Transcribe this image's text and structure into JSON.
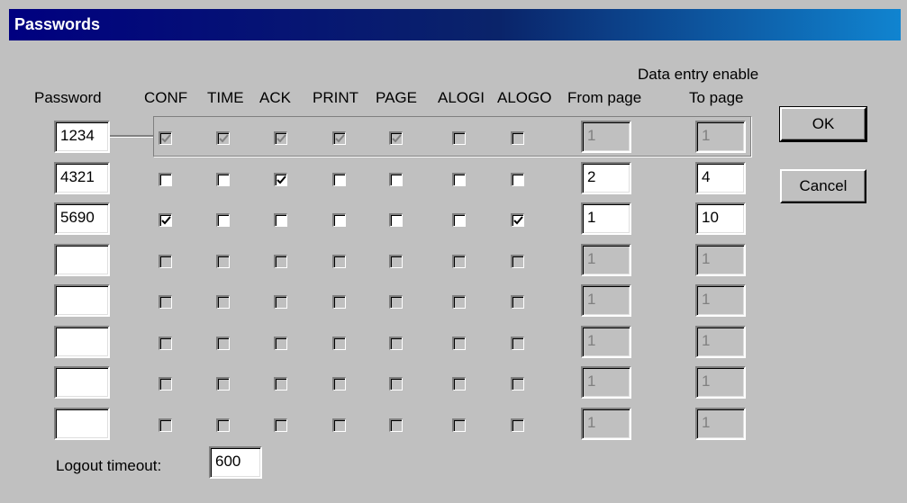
{
  "window": {
    "title": "Passwords"
  },
  "headers": {
    "password": "Password",
    "conf": "CONF",
    "time": "TIME",
    "ack": "ACK",
    "print": "PRINT",
    "page": "PAGE",
    "alogi": "ALOGI",
    "alogo": "ALOGO",
    "data_entry": "Data entry enable",
    "from_page": "From page",
    "to_page": "To page"
  },
  "rows": [
    {
      "password": "1234",
      "enabled": false,
      "checks": [
        true,
        true,
        true,
        true,
        true,
        false,
        false
      ],
      "from_page": "1",
      "to_page": "1"
    },
    {
      "password": "4321",
      "enabled": true,
      "checks": [
        false,
        false,
        true,
        false,
        false,
        false,
        false
      ],
      "from_page": "2",
      "to_page": "4"
    },
    {
      "password": "5690",
      "enabled": true,
      "checks": [
        true,
        false,
        false,
        false,
        false,
        false,
        true
      ],
      "from_page": "1",
      "to_page": "10"
    },
    {
      "password": "",
      "enabled": false,
      "checks": [
        false,
        false,
        false,
        false,
        false,
        false,
        false
      ],
      "from_page": "1",
      "to_page": "1"
    },
    {
      "password": "",
      "enabled": false,
      "checks": [
        false,
        false,
        false,
        false,
        false,
        false,
        false
      ],
      "from_page": "1",
      "to_page": "1"
    },
    {
      "password": "",
      "enabled": false,
      "checks": [
        false,
        false,
        false,
        false,
        false,
        false,
        false
      ],
      "from_page": "1",
      "to_page": "1"
    },
    {
      "password": "",
      "enabled": false,
      "checks": [
        false,
        false,
        false,
        false,
        false,
        false,
        false
      ],
      "from_page": "1",
      "to_page": "1"
    },
    {
      "password": "",
      "enabled": false,
      "checks": [
        false,
        false,
        false,
        false,
        false,
        false,
        false
      ],
      "from_page": "1",
      "to_page": "1"
    }
  ],
  "permission_keys": [
    "conf",
    "time",
    "ack",
    "print",
    "page",
    "alogi",
    "alogo"
  ],
  "logout": {
    "label": "Logout timeout:",
    "value": "600"
  },
  "buttons": {
    "ok": "OK",
    "cancel": "Cancel"
  },
  "colors": {
    "title_start": "#000080",
    "title_end": "#1084d0",
    "face": "#c0c0c0",
    "disabled_text": "#808080"
  }
}
